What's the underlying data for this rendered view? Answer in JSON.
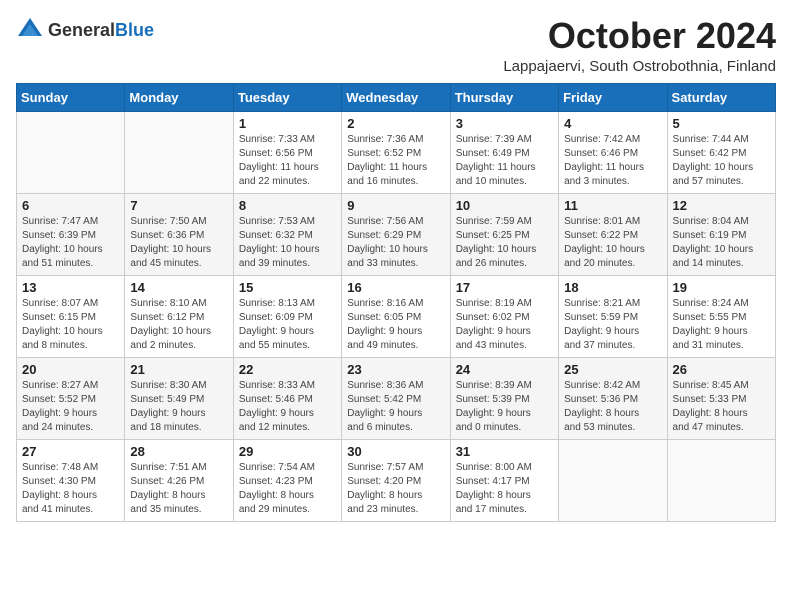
{
  "header": {
    "logo": {
      "general": "General",
      "blue": "Blue"
    },
    "title": "October 2024",
    "subtitle": "Lappajaervi, South Ostrobothnia, Finland"
  },
  "calendar": {
    "weekdays": [
      "Sunday",
      "Monday",
      "Tuesday",
      "Wednesday",
      "Thursday",
      "Friday",
      "Saturday"
    ],
    "weeks": [
      [
        {
          "day": "",
          "info": ""
        },
        {
          "day": "",
          "info": ""
        },
        {
          "day": "1",
          "info": "Sunrise: 7:33 AM\nSunset: 6:56 PM\nDaylight: 11 hours\nand 22 minutes."
        },
        {
          "day": "2",
          "info": "Sunrise: 7:36 AM\nSunset: 6:52 PM\nDaylight: 11 hours\nand 16 minutes."
        },
        {
          "day": "3",
          "info": "Sunrise: 7:39 AM\nSunset: 6:49 PM\nDaylight: 11 hours\nand 10 minutes."
        },
        {
          "day": "4",
          "info": "Sunrise: 7:42 AM\nSunset: 6:46 PM\nDaylight: 11 hours\nand 3 minutes."
        },
        {
          "day": "5",
          "info": "Sunrise: 7:44 AM\nSunset: 6:42 PM\nDaylight: 10 hours\nand 57 minutes."
        }
      ],
      [
        {
          "day": "6",
          "info": "Sunrise: 7:47 AM\nSunset: 6:39 PM\nDaylight: 10 hours\nand 51 minutes."
        },
        {
          "day": "7",
          "info": "Sunrise: 7:50 AM\nSunset: 6:36 PM\nDaylight: 10 hours\nand 45 minutes."
        },
        {
          "day": "8",
          "info": "Sunrise: 7:53 AM\nSunset: 6:32 PM\nDaylight: 10 hours\nand 39 minutes."
        },
        {
          "day": "9",
          "info": "Sunrise: 7:56 AM\nSunset: 6:29 PM\nDaylight: 10 hours\nand 33 minutes."
        },
        {
          "day": "10",
          "info": "Sunrise: 7:59 AM\nSunset: 6:25 PM\nDaylight: 10 hours\nand 26 minutes."
        },
        {
          "day": "11",
          "info": "Sunrise: 8:01 AM\nSunset: 6:22 PM\nDaylight: 10 hours\nand 20 minutes."
        },
        {
          "day": "12",
          "info": "Sunrise: 8:04 AM\nSunset: 6:19 PM\nDaylight: 10 hours\nand 14 minutes."
        }
      ],
      [
        {
          "day": "13",
          "info": "Sunrise: 8:07 AM\nSunset: 6:15 PM\nDaylight: 10 hours\nand 8 minutes."
        },
        {
          "day": "14",
          "info": "Sunrise: 8:10 AM\nSunset: 6:12 PM\nDaylight: 10 hours\nand 2 minutes."
        },
        {
          "day": "15",
          "info": "Sunrise: 8:13 AM\nSunset: 6:09 PM\nDaylight: 9 hours\nand 55 minutes."
        },
        {
          "day": "16",
          "info": "Sunrise: 8:16 AM\nSunset: 6:05 PM\nDaylight: 9 hours\nand 49 minutes."
        },
        {
          "day": "17",
          "info": "Sunrise: 8:19 AM\nSunset: 6:02 PM\nDaylight: 9 hours\nand 43 minutes."
        },
        {
          "day": "18",
          "info": "Sunrise: 8:21 AM\nSunset: 5:59 PM\nDaylight: 9 hours\nand 37 minutes."
        },
        {
          "day": "19",
          "info": "Sunrise: 8:24 AM\nSunset: 5:55 PM\nDaylight: 9 hours\nand 31 minutes."
        }
      ],
      [
        {
          "day": "20",
          "info": "Sunrise: 8:27 AM\nSunset: 5:52 PM\nDaylight: 9 hours\nand 24 minutes."
        },
        {
          "day": "21",
          "info": "Sunrise: 8:30 AM\nSunset: 5:49 PM\nDaylight: 9 hours\nand 18 minutes."
        },
        {
          "day": "22",
          "info": "Sunrise: 8:33 AM\nSunset: 5:46 PM\nDaylight: 9 hours\nand 12 minutes."
        },
        {
          "day": "23",
          "info": "Sunrise: 8:36 AM\nSunset: 5:42 PM\nDaylight: 9 hours\nand 6 minutes."
        },
        {
          "day": "24",
          "info": "Sunrise: 8:39 AM\nSunset: 5:39 PM\nDaylight: 9 hours\nand 0 minutes."
        },
        {
          "day": "25",
          "info": "Sunrise: 8:42 AM\nSunset: 5:36 PM\nDaylight: 8 hours\nand 53 minutes."
        },
        {
          "day": "26",
          "info": "Sunrise: 8:45 AM\nSunset: 5:33 PM\nDaylight: 8 hours\nand 47 minutes."
        }
      ],
      [
        {
          "day": "27",
          "info": "Sunrise: 7:48 AM\nSunset: 4:30 PM\nDaylight: 8 hours\nand 41 minutes."
        },
        {
          "day": "28",
          "info": "Sunrise: 7:51 AM\nSunset: 4:26 PM\nDaylight: 8 hours\nand 35 minutes."
        },
        {
          "day": "29",
          "info": "Sunrise: 7:54 AM\nSunset: 4:23 PM\nDaylight: 8 hours\nand 29 minutes."
        },
        {
          "day": "30",
          "info": "Sunrise: 7:57 AM\nSunset: 4:20 PM\nDaylight: 8 hours\nand 23 minutes."
        },
        {
          "day": "31",
          "info": "Sunrise: 8:00 AM\nSunset: 4:17 PM\nDaylight: 8 hours\nand 17 minutes."
        },
        {
          "day": "",
          "info": ""
        },
        {
          "day": "",
          "info": ""
        }
      ]
    ]
  }
}
